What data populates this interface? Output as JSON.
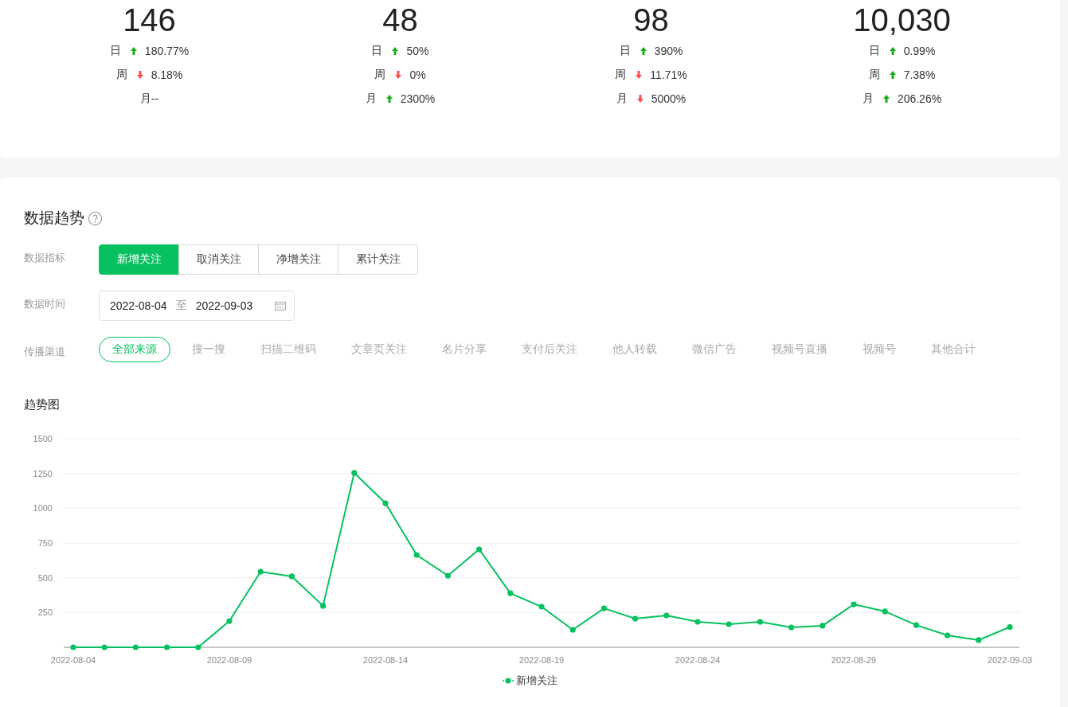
{
  "stats": [
    {
      "value": "146",
      "changes": [
        {
          "label": "日",
          "up": true,
          "value": "180.77%"
        },
        {
          "label": "周",
          "up": false,
          "value": "8.18%"
        },
        {
          "label": "月",
          "value": "--"
        }
      ]
    },
    {
      "value": "48",
      "changes": [
        {
          "label": "日",
          "up": true,
          "value": "50%"
        },
        {
          "label": "周",
          "up": false,
          "value": "0%"
        },
        {
          "label": "月",
          "up": true,
          "value": "2300%"
        }
      ]
    },
    {
      "value": "98",
      "changes": [
        {
          "label": "日",
          "up": true,
          "value": "390%"
        },
        {
          "label": "周",
          "up": false,
          "value": "11.71%"
        },
        {
          "label": "月",
          "up": false,
          "value": "5000%"
        }
      ]
    },
    {
      "value": "10,030",
      "changes": [
        {
          "label": "日",
          "up": true,
          "value": "0.99%"
        },
        {
          "label": "周",
          "up": true,
          "value": "7.38%"
        },
        {
          "label": "月",
          "up": true,
          "value": "206.26%"
        }
      ]
    }
  ],
  "trend": {
    "title": "数据趋势",
    "metric_label": "数据指标",
    "metrics": [
      {
        "label": "新增关注",
        "selected": true
      },
      {
        "label": "取消关注",
        "selected": false
      },
      {
        "label": "净增关注",
        "selected": false
      },
      {
        "label": "累计关注",
        "selected": false
      }
    ],
    "date_label": "数据时间",
    "date_start": "2022-08-04",
    "date_sep": "至",
    "date_end": "2022-09-03",
    "channel_label": "传播渠道",
    "channels": [
      {
        "label": "全部来源",
        "selected": true
      },
      {
        "label": "搜一搜",
        "selected": false
      },
      {
        "label": "扫描二维码",
        "selected": false
      },
      {
        "label": "文章页关注",
        "selected": false
      },
      {
        "label": "名片分享",
        "selected": false
      },
      {
        "label": "支付后关注",
        "selected": false
      },
      {
        "label": "他人转载",
        "selected": false
      },
      {
        "label": "微信广告",
        "selected": false
      },
      {
        "label": "视频号直播",
        "selected": false
      },
      {
        "label": "视频号",
        "selected": false
      },
      {
        "label": "其他合计",
        "selected": false
      }
    ],
    "chart_title": "趋势图",
    "chart_data": {
      "type": "line",
      "categories": [
        "2022-08-04",
        null,
        null,
        null,
        null,
        "2022-08-09",
        null,
        null,
        null,
        null,
        "2022-08-14",
        null,
        null,
        null,
        null,
        "2022-08-19",
        null,
        null,
        null,
        null,
        "2022-08-24",
        null,
        null,
        null,
        null,
        "2022-08-29",
        null,
        null,
        null,
        null,
        "2022-09-03"
      ],
      "grid": true,
      "series": [
        {
          "name": "新增关注",
          "color": "#07c160",
          "marker": "circle",
          "values": [
            0,
            0,
            0,
            0,
            0,
            189,
            544,
            510,
            298,
            1254,
            1036,
            664,
            515,
            704,
            389,
            292,
            126,
            280,
            206,
            229,
            183,
            166,
            183,
            143,
            155,
            309,
            258,
            160,
            86,
            52,
            146
          ]
        }
      ],
      "ylim": [
        0,
        1500
      ],
      "yticks": [
        {
          "value": 250,
          "label": "250"
        },
        {
          "value": 500,
          "label": "500"
        },
        {
          "value": 750,
          "label": "750"
        },
        {
          "value": 1000,
          "label": "1000"
        },
        {
          "value": 1250,
          "label": "1250"
        },
        {
          "value": 1500,
          "label": "1500"
        }
      ]
    }
  }
}
